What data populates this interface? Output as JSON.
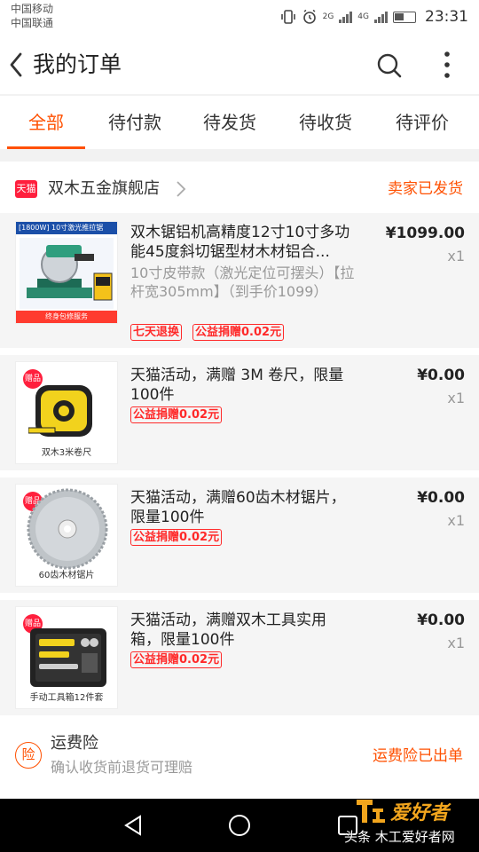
{
  "status_bar": {
    "carrier1": "中国移动",
    "carrier2": "中国联通",
    "network1": "2G",
    "network2": "4G",
    "time": "23:31"
  },
  "header": {
    "title": "我的订单",
    "back_icon": "back-arrow-icon",
    "search_icon": "search-icon",
    "more_icon": "more-vertical-icon"
  },
  "tabs": [
    {
      "label": "全部",
      "active": true
    },
    {
      "label": "待付款",
      "active": false
    },
    {
      "label": "待发货",
      "active": false
    },
    {
      "label": "待收货",
      "active": false
    },
    {
      "label": "待评价",
      "active": false
    }
  ],
  "order": {
    "platform_badge": "天猫",
    "shop_name": "双木五金旗舰店",
    "status": "卖家已发货",
    "items": [
      {
        "title": "双木锯铝机高精度12寸10寸多功能45度斜切锯型材木材铝合...",
        "sku": "10寸皮带款（激光定位可摆头）【拉杆宽305mm】（到手价1099）",
        "tags": [
          "七天退换",
          "公益捐赠0.02元"
        ],
        "price": "¥1099.00",
        "qty": "x1",
        "thumb_header": "[1800W] 10寸激光推拉锯",
        "thumb_footer": "终身包修服务"
      },
      {
        "gift_badge": "赠品",
        "title": "天猫活动，满赠 3M 卷尺，限量100件",
        "tags": [
          "公益捐赠0.02元"
        ],
        "price": "¥0.00",
        "qty": "x1",
        "thumb_caption": "双木3米卷尺"
      },
      {
        "gift_badge": "赠品",
        "title": "天猫活动，满赠60齿木材锯片，限量100件",
        "tags": [
          "公益捐赠0.02元"
        ],
        "price": "¥0.00",
        "qty": "x1",
        "thumb_caption": "60齿木材锯片"
      },
      {
        "gift_badge": "赠品",
        "title": "天猫活动，满赠双木工具实用箱，限量100件",
        "tags": [
          "公益捐赠0.02元"
        ],
        "price": "¥0.00",
        "qty": "x1",
        "thumb_caption": "手动工具箱12件套"
      }
    ],
    "insurance": {
      "icon_char": "险",
      "title": "运费险",
      "subtitle": "确认收货前退货可理赔",
      "status": "运费险已出单"
    }
  },
  "watermark": {
    "logo_text": "木工爱好者",
    "caption": "头条  木工爱好者网"
  },
  "colors": {
    "accent": "#ff5000",
    "tag_red": "#ff2a2a",
    "tmall_red": "#ff1f3d"
  }
}
